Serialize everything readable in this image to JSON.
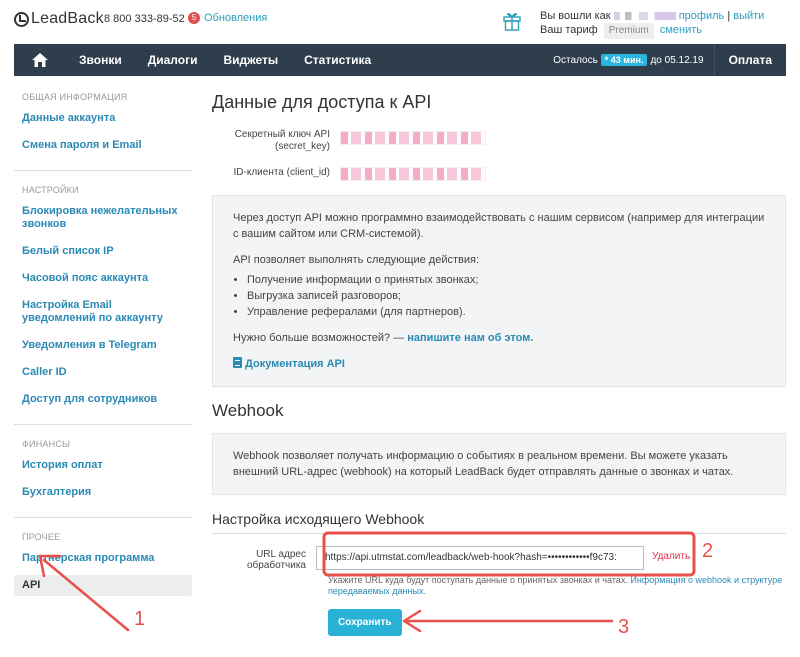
{
  "header": {
    "logo": "LeadBack",
    "phone": "8 800 333-89-52",
    "updates_count": "5",
    "updates_label": "Обновления",
    "logged_in_prefix": "Вы вошли как",
    "profile_link": "профиль",
    "separator": "|",
    "logout_link": "выйти",
    "tariff_label": "Ваш тариф",
    "tariff_value": "Premium",
    "change_link": "сменить"
  },
  "nav": {
    "items": [
      "Звонки",
      "Диалоги",
      "Виджеты",
      "Статистика"
    ],
    "remain_label": "Осталось",
    "remain_badge": "* 43 мин.",
    "remain_until": "до 05.12.19",
    "pay": "Оплата"
  },
  "sidebar": {
    "sections": [
      {
        "title": "ОБЩАЯ ИНФОРМАЦИЯ",
        "items": [
          "Данные аккаунта",
          "Смена пароля и Email"
        ]
      },
      {
        "title": "НАСТРОЙКИ",
        "items": [
          "Блокировка нежелательных звонков",
          "Белый список IP",
          "Часовой пояс аккаунта",
          "Настройка Email уведомлений по аккаунту",
          "Уведомления в Telegram",
          "Caller ID",
          "Доступ для сотрудников"
        ]
      },
      {
        "title": "ФИНАНСЫ",
        "items": [
          "История оплат",
          "Бухгалтерия"
        ]
      },
      {
        "title": "ПРОЧЕЕ",
        "items": [
          "Партнерская программа",
          "API"
        ]
      }
    ],
    "active": "API"
  },
  "api": {
    "title": "Данные для доступа к API",
    "secret_label_1": "Секретный ключ API",
    "secret_label_2": "(secret_key)",
    "client_label": "ID-клиента (client_id)",
    "info_p1": "Через доступ API можно программно взаимодействовать с нашим сервисом (например для интеграции с вашим сайтом или CRM-системой).",
    "info_p2": "API позволяет выполнять следующие действия:",
    "info_list": [
      "Получение информации о принятых звонках;",
      "Выгрузка записей разговоров;",
      "Управление рефералами (для партнеров)."
    ],
    "info_more": "Нужно больше возможностей? —",
    "info_more_link": "напишите нам об этом.",
    "docs_link": "Документация API"
  },
  "webhook": {
    "title": "Webhook",
    "info": "Webhook позволяет получать информацию о событиях в реальном времени. Вы можете указать внешний URL-адрес (webhook) на который LeadBack будет отправлять данные о звонках и чатах.",
    "outgoing_title": "Настройка исходящего Webhook",
    "url_label": "URL адрес обработчика",
    "url_value": "https://api.utmstat.com/leadback/web-hook?hash=••••••••••••f9c73:",
    "delete": "Удалить",
    "hint": "Укажите URL куда будут поступать данные о принятых звонках и чатах.",
    "hint_link": "Информация о webhook и структуре передаваемых данных.",
    "save": "Сохранить"
  },
  "annotations": [
    "1",
    "2",
    "3"
  ],
  "colors": {
    "annotation": "#e8504c",
    "accent": "#2ab2d6",
    "nav_bg": "#2f3e4c"
  }
}
